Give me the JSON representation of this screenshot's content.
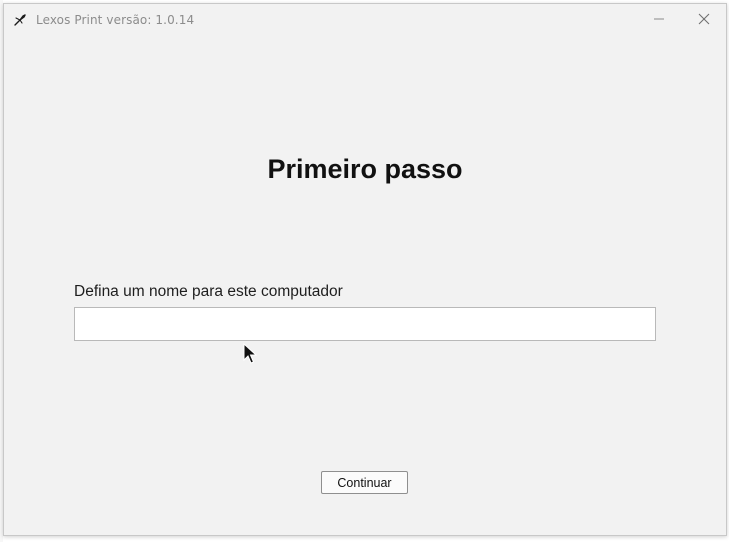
{
  "window": {
    "title": "Lexos Print versão: 1.0.14",
    "icon": "lexos-app-icon",
    "controls": [
      "minimize-icon",
      "close-icon"
    ]
  },
  "main": {
    "heading": "Primeiro passo",
    "name_field": {
      "label": "Defina um nome para este computador",
      "value": "",
      "placeholder": ""
    },
    "continue_label": "Continuar"
  },
  "colors": {
    "window_bg": "#f2f2f2",
    "title_text": "#8c8c8c",
    "input_border": "#b9b9b9",
    "button_border": "#8f8f8f"
  }
}
